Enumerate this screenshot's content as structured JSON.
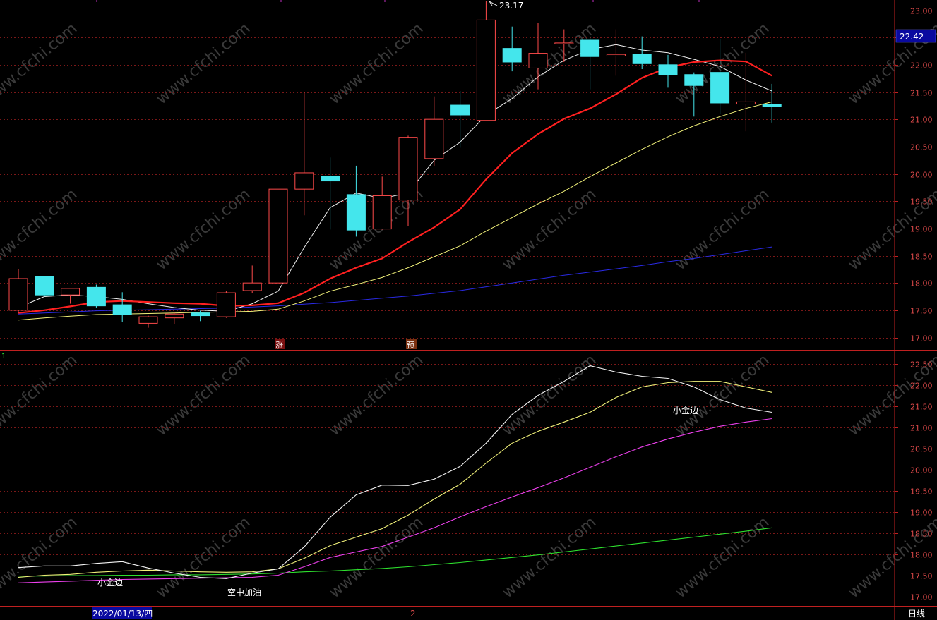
{
  "colors": {
    "bg": "#000000",
    "frame": "#c02020",
    "grid": "#7a1818",
    "axis_text": "#d84848",
    "up": "#ff4a4a",
    "down": "#44e6ec",
    "ma5": "#f0f0f0",
    "ma10": "#ff2020",
    "ma20": "#f2f27a",
    "ma60": "#2a2ae6",
    "sub_a": "#f4f4f4",
    "sub_b": "#f2f27a",
    "sub_c": "#ee40ee",
    "sub_d": "#2ee02e",
    "watermark": "#3a3a3a"
  },
  "price_panel": {
    "current_price": "22.42",
    "high_label": "23.17",
    "signal_markers": [
      "涨",
      "预"
    ]
  },
  "sub_panel": {
    "index_label": "1",
    "annotations": [
      "小金边",
      "空中加油",
      "小金边"
    ]
  },
  "bottom_bar": {
    "date_label": "2022/01/13/四",
    "marker": "2",
    "period": "日线"
  },
  "watermark": "www.cfchi.com",
  "chart_data": [
    {
      "type": "candlestick",
      "ylim": [
        16.9,
        23.2
      ],
      "yticks": [
        "17.00",
        "17.50",
        "18.00",
        "18.50",
        "19.00",
        "19.50",
        "20.00",
        "20.50",
        "21.00",
        "21.50",
        "22.00",
        "22.50",
        "23.00"
      ],
      "grid": true,
      "candles": [
        {
          "o": 17.5,
          "h": 18.25,
          "l": 17.45,
          "c": 18.08
        },
        {
          "o": 18.12,
          "h": 18.12,
          "l": 17.75,
          "c": 17.78
        },
        {
          "o": 17.78,
          "h": 17.9,
          "l": 17.62,
          "c": 17.9
        },
        {
          "o": 17.92,
          "h": 17.97,
          "l": 17.55,
          "c": 17.58
        },
        {
          "o": 17.6,
          "h": 17.83,
          "l": 17.28,
          "c": 17.42
        },
        {
          "o": 17.26,
          "h": 17.4,
          "l": 17.18,
          "c": 17.38
        },
        {
          "o": 17.36,
          "h": 17.46,
          "l": 17.25,
          "c": 17.43
        },
        {
          "o": 17.45,
          "h": 17.49,
          "l": 17.3,
          "c": 17.4
        },
        {
          "o": 17.38,
          "h": 17.85,
          "l": 17.36,
          "c": 17.82
        },
        {
          "o": 17.86,
          "h": 18.32,
          "l": 17.82,
          "c": 18.0
        },
        {
          "o": 18.0,
          "h": 19.72,
          "l": 18.0,
          "c": 19.72
        },
        {
          "o": 19.72,
          "h": 21.5,
          "l": 19.24,
          "c": 20.02
        },
        {
          "o": 19.95,
          "h": 20.3,
          "l": 18.98,
          "c": 19.87
        },
        {
          "o": 19.62,
          "h": 20.15,
          "l": 18.85,
          "c": 18.97
        },
        {
          "o": 18.99,
          "h": 19.95,
          "l": 18.98,
          "c": 19.6
        },
        {
          "o": 19.52,
          "h": 20.7,
          "l": 19.05,
          "c": 20.67
        },
        {
          "o": 20.28,
          "h": 21.42,
          "l": 20.15,
          "c": 21.0
        },
        {
          "o": 21.26,
          "h": 21.52,
          "l": 20.48,
          "c": 21.08
        },
        {
          "o": 20.98,
          "h": 23.17,
          "l": 20.98,
          "c": 22.82
        },
        {
          "o": 22.3,
          "h": 22.7,
          "l": 21.88,
          "c": 22.05
        },
        {
          "o": 21.94,
          "h": 22.76,
          "l": 21.55,
          "c": 22.21
        },
        {
          "o": 22.38,
          "h": 22.65,
          "l": 22.05,
          "c": 22.4
        },
        {
          "o": 22.45,
          "h": 22.52,
          "l": 21.55,
          "c": 22.15
        },
        {
          "o": 22.16,
          "h": 22.65,
          "l": 21.8,
          "c": 22.19
        },
        {
          "o": 22.19,
          "h": 22.52,
          "l": 21.92,
          "c": 22.02
        },
        {
          "o": 22.0,
          "h": 22.18,
          "l": 21.58,
          "c": 21.82
        },
        {
          "o": 21.82,
          "h": 21.86,
          "l": 21.05,
          "c": 21.62
        },
        {
          "o": 21.86,
          "h": 22.47,
          "l": 21.1,
          "c": 21.3
        },
        {
          "o": 21.28,
          "h": 22.22,
          "l": 20.78,
          "c": 21.32
        },
        {
          "o": 21.28,
          "h": 21.65,
          "l": 20.94,
          "c": 21.23
        }
      ],
      "series": [
        {
          "values": [
            17.55,
            17.75,
            17.78,
            17.75,
            17.7,
            17.62,
            17.55,
            17.5,
            17.48,
            17.62,
            17.85,
            18.65,
            19.38,
            19.65,
            19.55,
            19.65,
            20.25,
            20.58,
            21.08,
            21.38,
            21.78,
            22.08,
            22.28,
            22.37,
            22.27,
            22.22,
            22.1,
            21.97,
            21.72,
            21.52
          ]
        },
        {
          "values": [
            17.45,
            17.5,
            17.57,
            17.65,
            17.67,
            17.65,
            17.63,
            17.62,
            17.58,
            17.59,
            17.63,
            17.82,
            18.08,
            18.28,
            18.45,
            18.75,
            19.02,
            19.35,
            19.9,
            20.38,
            20.73,
            21.01,
            21.2,
            21.46,
            21.76,
            21.95,
            22.05,
            22.08,
            22.06,
            21.8
          ]
        },
        {
          "values": [
            17.32,
            17.36,
            17.39,
            17.42,
            17.43,
            17.44,
            17.45,
            17.46,
            17.47,
            17.48,
            17.52,
            17.67,
            17.85,
            17.97,
            18.1,
            18.28,
            18.48,
            18.68,
            18.95,
            19.2,
            19.45,
            19.68,
            19.95,
            20.2,
            20.45,
            20.68,
            20.88,
            21.05,
            21.2,
            21.32
          ]
        },
        {
          "values": [
            17.43,
            17.45,
            17.47,
            17.49,
            17.5,
            17.51,
            17.52,
            17.53,
            17.54,
            17.56,
            17.58,
            17.61,
            17.64,
            17.68,
            17.72,
            17.76,
            17.81,
            17.86,
            17.93,
            18.0,
            18.07,
            18.14,
            18.2,
            18.26,
            18.32,
            18.39,
            18.45,
            18.52,
            18.59,
            18.66
          ]
        }
      ]
    },
    {
      "type": "line",
      "ylim": [
        16.9,
        22.65
      ],
      "yticks": [
        "17.00",
        "17.50",
        "18.00",
        "18.50",
        "19.00",
        "19.50",
        "20.00",
        "20.50",
        "21.00",
        "21.50",
        "22.00",
        "22.50"
      ],
      "grid": true,
      "series": [
        {
          "values": [
            17.68,
            17.72,
            17.72,
            17.78,
            17.82,
            17.67,
            17.55,
            17.45,
            17.42,
            17.55,
            17.65,
            18.17,
            18.87,
            19.4,
            19.63,
            19.62,
            19.77,
            20.07,
            20.62,
            21.3,
            21.75,
            22.08,
            22.45,
            22.3,
            22.2,
            22.15,
            21.95,
            21.65,
            21.45,
            21.35
          ]
        },
        {
          "values": [
            17.45,
            17.5,
            17.52,
            17.57,
            17.6,
            17.62,
            17.6,
            17.58,
            17.57,
            17.58,
            17.65,
            17.9,
            18.2,
            18.4,
            18.6,
            18.92,
            19.3,
            19.65,
            20.15,
            20.62,
            20.9,
            21.12,
            21.35,
            21.7,
            21.95,
            22.05,
            22.08,
            22.08,
            21.95,
            21.82
          ]
        },
        {
          "values": [
            17.32,
            17.34,
            17.36,
            17.38,
            17.4,
            17.41,
            17.42,
            17.43,
            17.44,
            17.45,
            17.5,
            17.7,
            17.92,
            18.05,
            18.18,
            18.4,
            18.62,
            18.88,
            19.12,
            19.35,
            19.57,
            19.8,
            20.05,
            20.3,
            20.53,
            20.72,
            20.88,
            21.02,
            21.12,
            21.2
          ]
        },
        {
          "values": [
            17.48,
            17.48,
            17.49,
            17.49,
            17.5,
            17.5,
            17.51,
            17.51,
            17.52,
            17.53,
            17.55,
            17.58,
            17.6,
            17.63,
            17.66,
            17.7,
            17.75,
            17.8,
            17.86,
            17.92,
            17.98,
            18.05,
            18.12,
            18.19,
            18.26,
            18.33,
            18.4,
            18.47,
            18.54,
            18.62
          ]
        }
      ]
    }
  ]
}
